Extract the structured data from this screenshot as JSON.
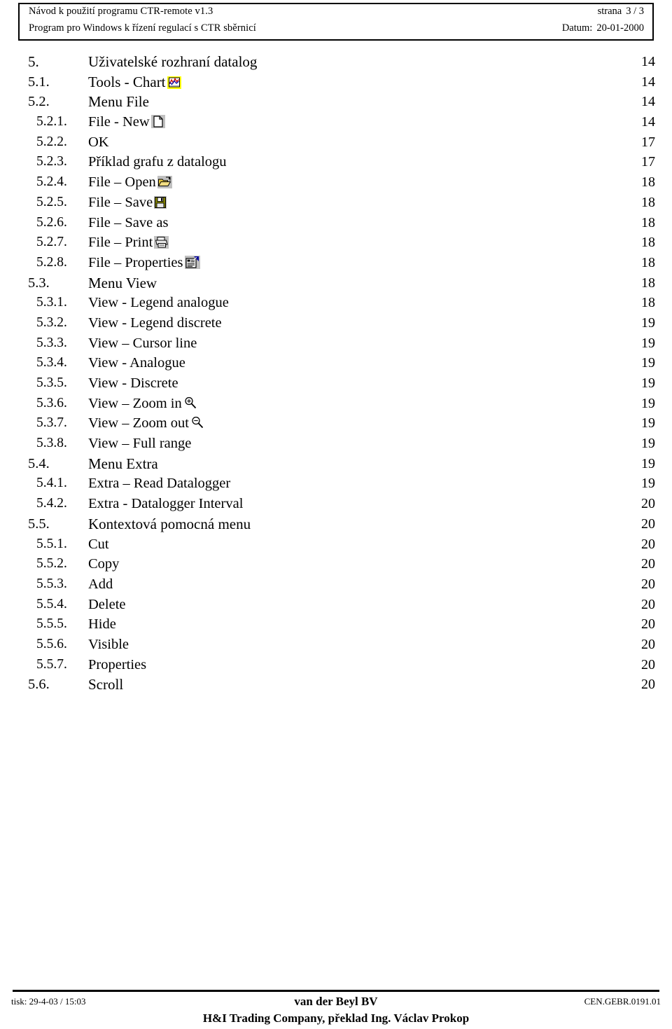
{
  "header": {
    "line1_left": "Návod k použití programu CTR-remote v1.3",
    "line1_right_label": "strana",
    "line1_right_value": "3 / 3",
    "line2_left": "Program pro Windows k řízení regulací s CTR sběrnicí",
    "line2_right_label": "Datum:",
    "line2_right_value": "20-01-2000"
  },
  "toc": {
    "entries": [
      {
        "num": "5.",
        "label": "Uživatelské rozhraní datalog",
        "page": "14",
        "level": 0,
        "icon": ""
      },
      {
        "num": "5.1.",
        "label": "Tools - Chart",
        "page": "14",
        "level": 1,
        "icon": "chart-icon"
      },
      {
        "num": "5.2.",
        "label": "Menu File",
        "page": "14",
        "level": 1,
        "icon": ""
      },
      {
        "num": "5.2.1.",
        "label": "File - New",
        "page": "14",
        "level": 3,
        "icon": "new-document-icon"
      },
      {
        "num": "5.2.2.",
        "label": "OK",
        "page": "17",
        "level": 3,
        "icon": ""
      },
      {
        "num": "5.2.3.",
        "label": "Příklad grafu z datalogu",
        "page": "17",
        "level": 3,
        "icon": ""
      },
      {
        "num": "5.2.4.",
        "label": "File – Open",
        "page": "18",
        "level": 3,
        "icon": "open-folder-icon"
      },
      {
        "num": "5.2.5.",
        "label": "File – Save",
        "page": "18",
        "level": 3,
        "icon": "save-floppy-icon"
      },
      {
        "num": "5.2.6.",
        "label": "File – Save as",
        "page": "18",
        "level": 3,
        "icon": ""
      },
      {
        "num": "5.2.7.",
        "label": "File – Print",
        "page": "18",
        "level": 3,
        "icon": "printer-icon"
      },
      {
        "num": "5.2.8.",
        "label": "File – Properties",
        "page": "18",
        "level": 3,
        "icon": "properties-icon"
      },
      {
        "num": "5.3.",
        "label": "Menu View",
        "page": "18",
        "level": 1,
        "icon": ""
      },
      {
        "num": "5.3.1.",
        "label": "View - Legend analogue",
        "page": "18",
        "level": 3,
        "icon": ""
      },
      {
        "num": "5.3.2.",
        "label": "View - Legend discrete",
        "page": "19",
        "level": 3,
        "icon": ""
      },
      {
        "num": "5.3.3.",
        "label": "View – Cursor line",
        "page": "19",
        "level": 3,
        "icon": ""
      },
      {
        "num": "5.3.4.",
        "label": "View - Analogue",
        "page": "19",
        "level": 3,
        "icon": ""
      },
      {
        "num": "5.3.5.",
        "label": "View - Discrete",
        "page": "19",
        "level": 3,
        "icon": ""
      },
      {
        "num": "5.3.6.",
        "label": "View – Zoom in",
        "page": "19",
        "level": 3,
        "icon": "zoom-in-icon"
      },
      {
        "num": "5.3.7.",
        "label": "View – Zoom out",
        "page": "19",
        "level": 3,
        "icon": "zoom-out-icon"
      },
      {
        "num": "5.3.8.",
        "label": "View – Full range",
        "page": "19",
        "level": 3,
        "icon": ""
      },
      {
        "num": "5.4.",
        "label": "Menu Extra",
        "page": "19",
        "level": 1,
        "icon": ""
      },
      {
        "num": "5.4.1.",
        "label": "Extra – Read Datalogger",
        "page": "19",
        "level": 3,
        "icon": ""
      },
      {
        "num": "5.4.2.",
        "label": "Extra - Datalogger Interval",
        "page": "20",
        "level": 3,
        "icon": ""
      },
      {
        "num": "5.5.",
        "label": "Kontextová pomocná menu",
        "page": "20",
        "level": 1,
        "icon": ""
      },
      {
        "num": "5.5.1.",
        "label": "Cut",
        "page": "20",
        "level": 3,
        "icon": ""
      },
      {
        "num": "5.5.2.",
        "label": "Copy",
        "page": "20",
        "level": 3,
        "icon": ""
      },
      {
        "num": "5.5.3.",
        "label": "Add",
        "page": "20",
        "level": 3,
        "icon": ""
      },
      {
        "num": "5.5.4.",
        "label": "Delete",
        "page": "20",
        "level": 3,
        "icon": ""
      },
      {
        "num": "5.5.5.",
        "label": "Hide",
        "page": "20",
        "level": 3,
        "icon": ""
      },
      {
        "num": "5.5.6.",
        "label": "Visible",
        "page": "20",
        "level": 3,
        "icon": ""
      },
      {
        "num": "5.5.7.",
        "label": "Properties",
        "page": "20",
        "level": 3,
        "icon": ""
      },
      {
        "num": "5.6.",
        "label": "Scroll",
        "page": "20",
        "level": 1,
        "icon": ""
      }
    ]
  },
  "footer": {
    "left": "tisk: 29-4-03 / 15:03",
    "center_line1": "van der Beyl BV",
    "center_line2": "H&I Trading Company, překlad Ing. Václav Prokop",
    "right": "CEN.GEBR.0191.01"
  },
  "colors": {
    "chart_icon_background": "#ffff00",
    "chart_icon_line_red": "#cc0000",
    "chart_icon_line_blue": "#0000aa",
    "folder_yellow": "#e8c840",
    "floppy_olive": "#808000",
    "icon_gray": "#c0c0c0",
    "properties_blue": "#000099",
    "text": "#000000",
    "page_background": "#ffffff"
  }
}
